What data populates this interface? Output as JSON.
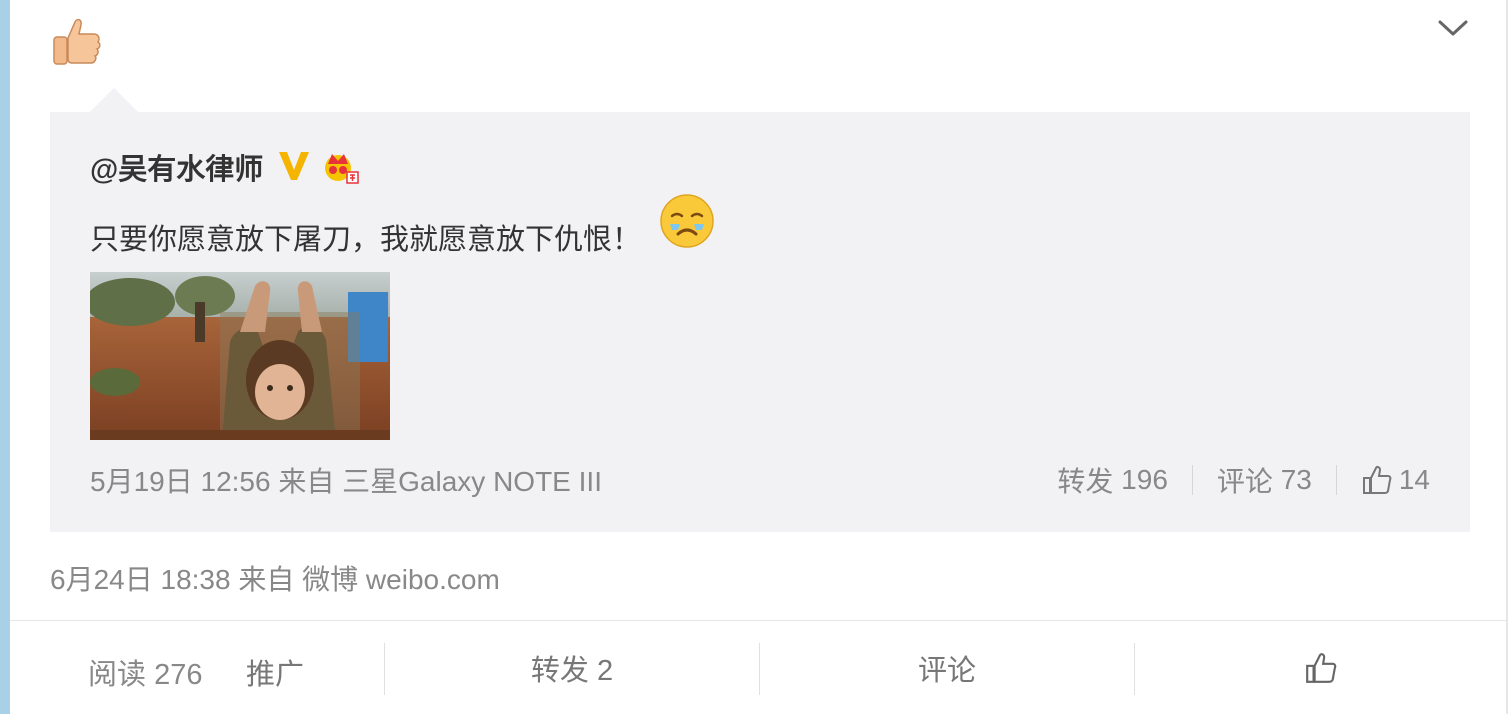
{
  "post": {
    "emoji": "thumbs-up-emoji",
    "collapse_icon": "chevron-down-icon",
    "timestamp": "6月24日 18:38",
    "from_label": "来自",
    "source": "微博 weibo.com"
  },
  "quoted": {
    "author": "@吴有水律师",
    "verified_badge": "verified-v-icon",
    "member_badge": "crown-member-icon",
    "text": "只要你愿意放下屠刀，我就愿意放下仇恨！",
    "emoji": "crying-emoji",
    "image": "photo-child-raising-hands",
    "timestamp": "5月19日 12:56",
    "from_label": "来自",
    "source": "三星Galaxy NOTE III",
    "actions": {
      "repost_label": "转发",
      "repost_count": "196",
      "comment_label": "评论",
      "comment_count": "73",
      "like_count": "14"
    }
  },
  "footer": {
    "read_label": "阅读",
    "read_count": "276",
    "promote_label": "推广",
    "repost_label": "转发 2",
    "comment_label": "评论"
  },
  "colors": {
    "quote_bg": "#f2f2f5",
    "meta_text": "#888888",
    "accent_yellow": "#f5b400",
    "left_strip": "#a8d0e6"
  }
}
